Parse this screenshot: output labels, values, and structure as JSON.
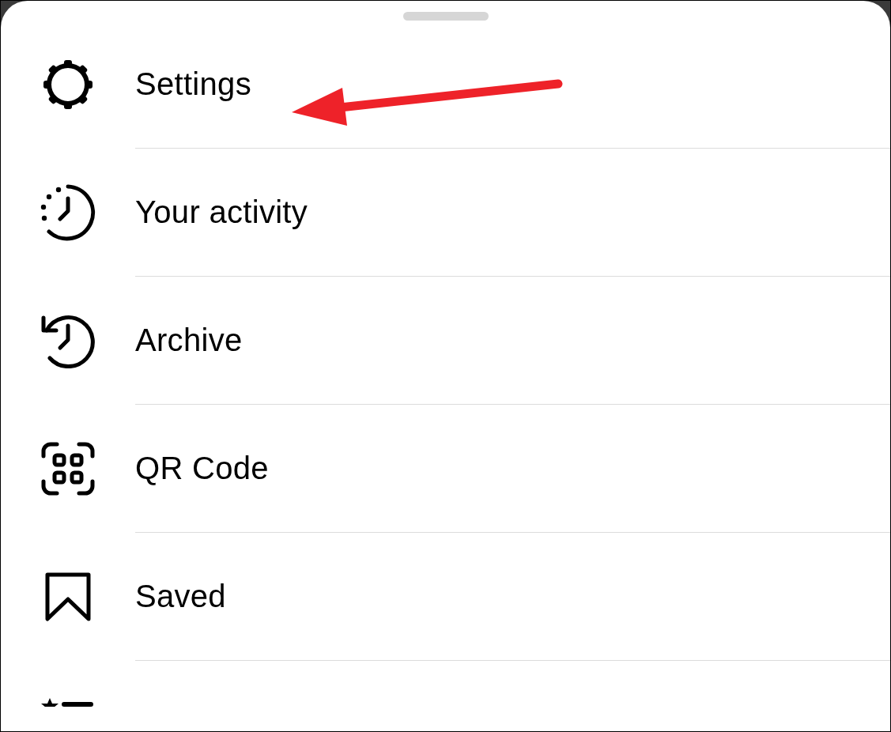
{
  "menu": {
    "items": [
      {
        "kind": "gear",
        "label": "Settings"
      },
      {
        "kind": "activity",
        "label": "Your activity"
      },
      {
        "kind": "archive",
        "label": "Archive"
      },
      {
        "kind": "qr",
        "label": "QR Code"
      },
      {
        "kind": "bookmark",
        "label": "Saved"
      },
      {
        "kind": "star-list"
      }
    ]
  }
}
